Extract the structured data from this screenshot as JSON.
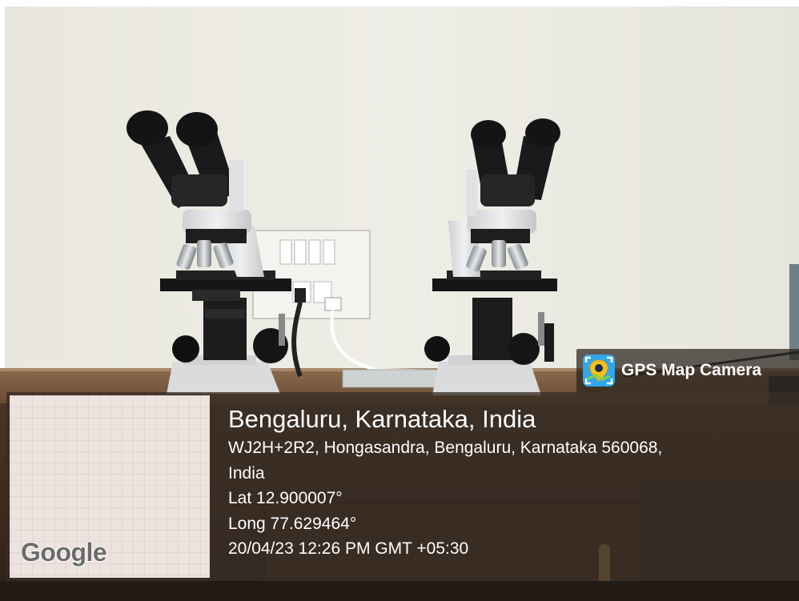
{
  "overlay_badge": {
    "label": "GPS Map Camera",
    "icon": "map-pin-camera-icon",
    "accent_color": "#2fa7ea"
  },
  "geotag": {
    "place": "Bengaluru, Karnataka, India",
    "address_line_1": "WJ2H+2R2, Hongasandra, Bengaluru, Karnataka 560068,",
    "address_line_2": "India",
    "latitude": "Lat 12.900007°",
    "longitude": "Long 77.629464°",
    "datetime": "20/04/23 12:26 PM GMT +05:30"
  },
  "map": {
    "logo_text": "Google"
  }
}
